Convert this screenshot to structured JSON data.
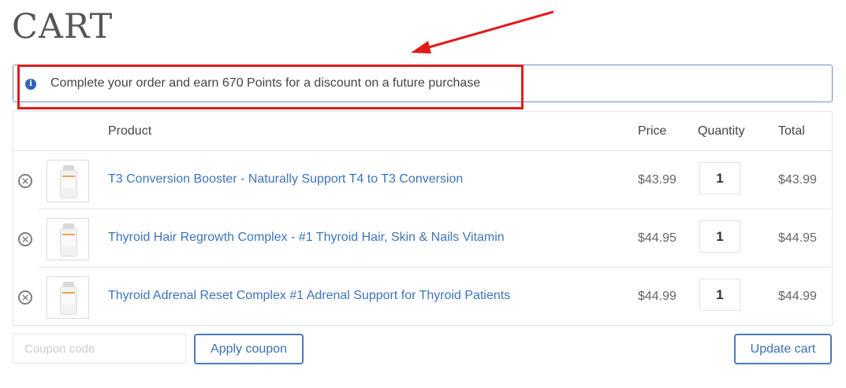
{
  "page": {
    "title": "CART"
  },
  "notice": {
    "icon": "info-icon",
    "text": "Complete your order and earn 670 Points for a discount on a future purchase"
  },
  "annotation": {
    "color": "#e21a1a"
  },
  "table": {
    "headers": {
      "product": "Product",
      "price": "Price",
      "quantity": "Quantity",
      "total": "Total"
    },
    "rows": [
      {
        "name": "T3 Conversion Booster - Naturally Support T4 to T3 Conversion",
        "price": "$43.99",
        "quantity": "1",
        "total": "$43.99"
      },
      {
        "name": "Thyroid Hair Regrowth Complex - #1 Thyroid Hair, Skin & Nails Vitamin",
        "price": "$44.95",
        "quantity": "1",
        "total": "$44.95"
      },
      {
        "name": "Thyroid Adrenal Reset Complex #1 Adrenal Support for Thyroid Patients",
        "price": "$44.99",
        "quantity": "1",
        "total": "$44.99"
      }
    ]
  },
  "coupon": {
    "placeholder": "Coupon code",
    "apply_label": "Apply coupon"
  },
  "actions": {
    "update_label": "Update cart"
  },
  "colors": {
    "link": "#3e74b9",
    "button_border": "#4a78b8",
    "notice_border": "#6f8fbf",
    "info_icon": "#2e63b8"
  }
}
